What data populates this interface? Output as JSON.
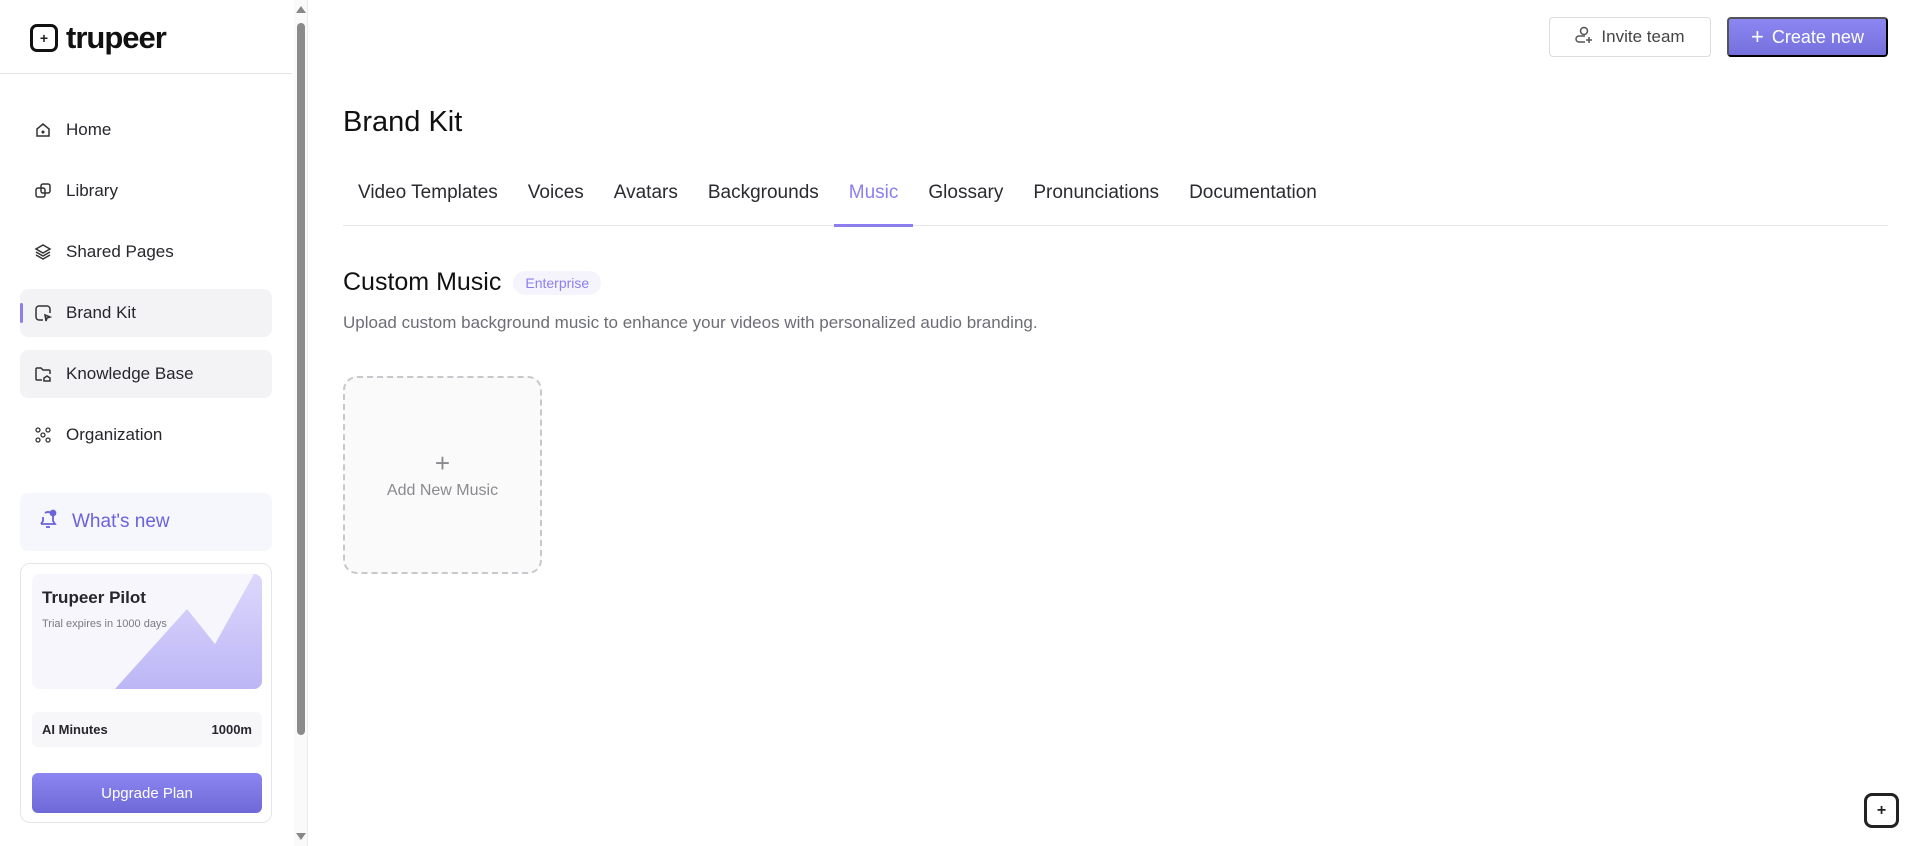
{
  "brand": {
    "name": "trupeer"
  },
  "sidebar": {
    "items": [
      {
        "label": "Home",
        "icon": "home-icon"
      },
      {
        "label": "Library",
        "icon": "library-icon"
      },
      {
        "label": "Shared Pages",
        "icon": "layers-icon"
      },
      {
        "label": "Brand Kit",
        "icon": "brand-kit-icon"
      },
      {
        "label": "Knowledge Base",
        "icon": "folder-icon"
      },
      {
        "label": "Organization",
        "icon": "organization-icon"
      }
    ],
    "whats_new": "What's new",
    "plan": {
      "name": "Trupeer Pilot",
      "trial": "Trial expires in 1000 days",
      "minutes_label": "AI Minutes",
      "minutes_value": "1000m",
      "upgrade": "Upgrade Plan"
    }
  },
  "header": {
    "invite": "Invite team",
    "create": "Create new"
  },
  "main": {
    "title": "Brand Kit",
    "tabs": [
      "Video Templates",
      "Voices",
      "Avatars",
      "Backgrounds",
      "Music",
      "Glossary",
      "Pronunciations",
      "Documentation"
    ],
    "active_tab": "Music",
    "section_title": "Custom Music",
    "badge": "Enterprise",
    "description": "Upload custom background music to enhance your videos with personalized audio branding.",
    "add_label": "Add New Music"
  },
  "colors": {
    "accent": "#8b7ff0",
    "button": "#7c76e6"
  }
}
